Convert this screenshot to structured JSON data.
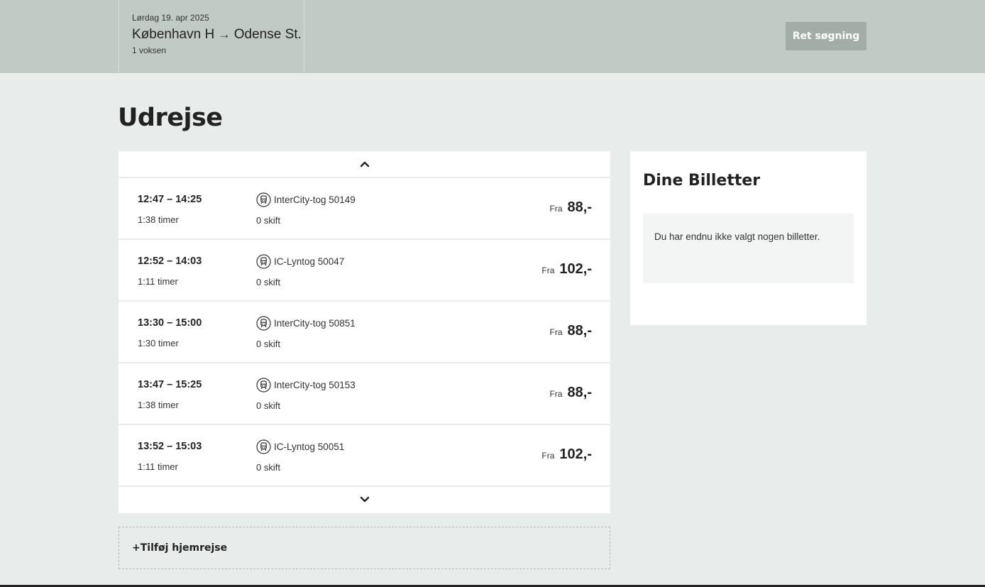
{
  "header": {
    "date": "Lørdag 19. apr 2025",
    "from": "København H",
    "arrow": "→",
    "to": "Odense St.",
    "passengers": "1 voksen",
    "edit_label": "Ret søgning"
  },
  "page_title": "Udrejse",
  "journeys": [
    {
      "times": "12:47 – 14:25",
      "duration": "1:38 timer",
      "train": "InterCity-tog 50149",
      "changes": "0 skift",
      "price_prefix": "Fra",
      "price": "88,-"
    },
    {
      "times": "12:52 – 14:03",
      "duration": "1:11 timer",
      "train": "IC-Lyntog 50047",
      "changes": "0 skift",
      "price_prefix": "Fra",
      "price": "102,-"
    },
    {
      "times": "13:30 – 15:00",
      "duration": "1:30 timer",
      "train": "InterCity-tog 50851",
      "changes": "0 skift",
      "price_prefix": "Fra",
      "price": "88,-"
    },
    {
      "times": "13:47 – 15:25",
      "duration": "1:38 timer",
      "train": "InterCity-tog 50153",
      "changes": "0 skift",
      "price_prefix": "Fra",
      "price": "88,-"
    },
    {
      "times": "13:52 – 15:03",
      "duration": "1:11 timer",
      "train": "IC-Lyntog 50051",
      "changes": "0 skift",
      "price_prefix": "Fra",
      "price": "102,-"
    }
  ],
  "add_return_label": "+Tilføj hjemrejse",
  "tickets": {
    "title": "Dine Billetter",
    "empty_message": "Du har endnu ikke valgt nogen billetter."
  },
  "icons": {
    "scroll_up": "chevron-up-icon",
    "scroll_down": "chevron-down-icon",
    "train": "train-icon"
  },
  "colors": {
    "header_bg": "#c2cac5",
    "page_bg": "#e8ecea",
    "button_bg": "#a3ada8"
  }
}
